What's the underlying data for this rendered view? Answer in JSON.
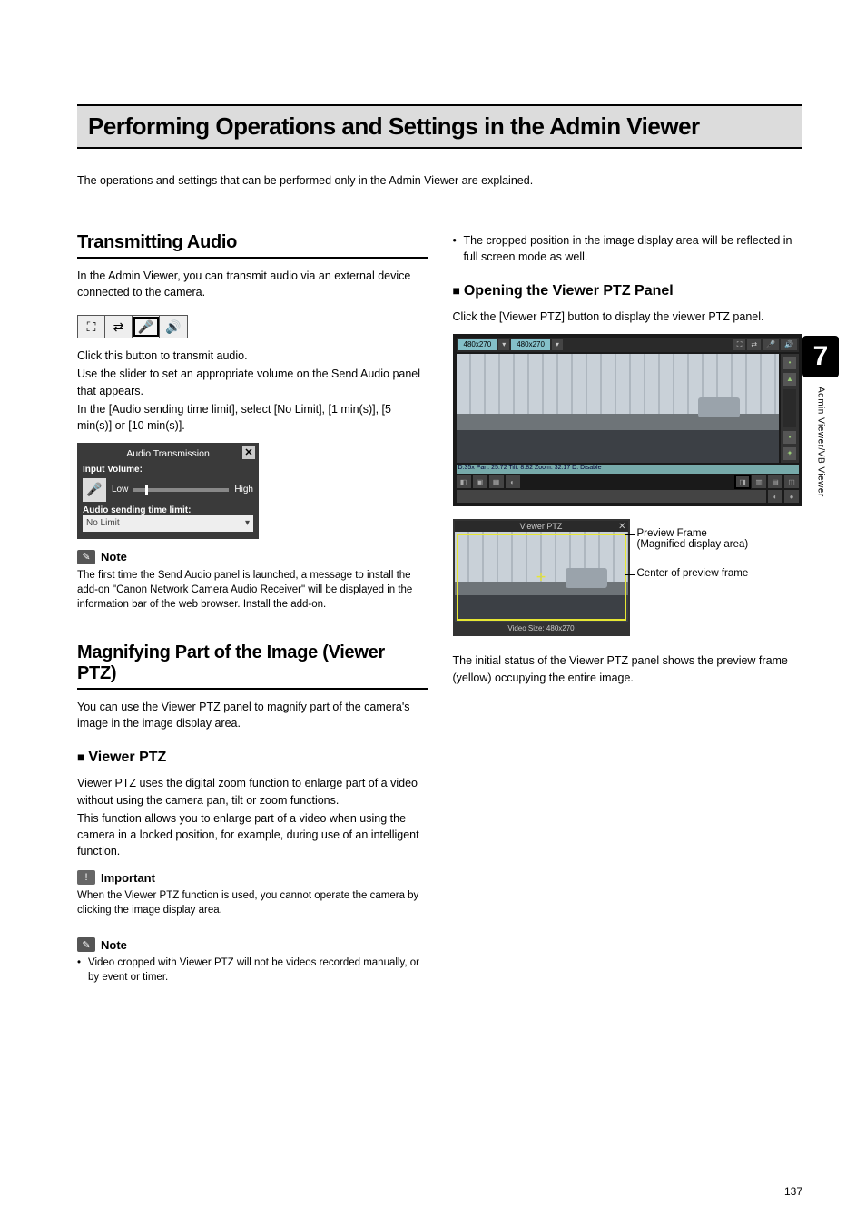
{
  "chapter": {
    "number": "7",
    "side_label": "Admin Viewer/VB Viewer"
  },
  "page_number": "137",
  "heading": "Performing Operations and Settings in the Admin Viewer",
  "intro": "The operations and settings that can be performed only in the Admin Viewer are explained.",
  "left": {
    "sec1": {
      "title": "Transmitting Audio",
      "p1": "In the Admin Viewer, you can transmit audio via an external device connected to the camera.",
      "p2": "Click this button to transmit audio.",
      "p3": "Use the slider to set an appropriate volume on the Send Audio panel that appears.",
      "p4": "In the [Audio sending time limit], select [No Limit], [1 min(s)], [5 min(s)] or [10 min(s)].",
      "audio_panel": {
        "title": "Audio Transmission",
        "input_volume": "Input Volume:",
        "low": "Low",
        "high": "High",
        "time_limit_label": "Audio sending time limit:",
        "time_limit_value": "No Limit"
      },
      "note_label": "Note",
      "note_text": "The first time the Send Audio panel is launched, a message to install the add-on \"Canon Network Camera Audio Receiver\" will be displayed in the information bar of the web browser. Install the add-on."
    },
    "sec2": {
      "title": "Magnifying Part of the Image (Viewer PTZ)",
      "p1": "You can use the Viewer PTZ panel to magnify part of the camera's image in the image display area.",
      "sub1": {
        "title": "Viewer PTZ",
        "p1": "Viewer PTZ uses the digital zoom function to enlarge part of a video without using the camera pan, tilt or zoom functions.",
        "p2": "This function allows you to enlarge part of a video when using the camera in a locked position, for example, during use of an intelligent function.",
        "important_label": "Important",
        "important_text": "When the Viewer PTZ function is used, you cannot operate the camera by clicking the image display area.",
        "note_label": "Note",
        "note_item": "Video cropped with Viewer PTZ will not be videos recorded manually, or by event or timer."
      }
    }
  },
  "right": {
    "bullet1": "The cropped position in the image display area will be reflected in full screen mode as well.",
    "sub1": {
      "title": "Opening the Viewer PTZ Panel",
      "p1": "Click the [Viewer PTZ] button to display the viewer PTZ panel.",
      "viewer": {
        "chip1": "480x270",
        "chip2": "480x270",
        "status": "D.35x Pan: 25.72 Tilt: 8.82 Zoom: 32.17 D: Disable"
      },
      "preview": {
        "title": "Viewer PTZ",
        "footer": "Video Size: 480x270",
        "label1": "Preview Frame",
        "label1b": "(Magnified display area)",
        "label2": "Center of preview frame"
      },
      "p2": "The initial status of the Viewer PTZ panel shows the preview frame (yellow) occupying the entire image."
    }
  },
  "icons": {
    "fullscreen": "⛶",
    "swap": "⇄",
    "mic": "🎤",
    "speaker": "🔊",
    "note": "✎",
    "important": "!",
    "dropdown": "▾",
    "close": "✕",
    "cross": "✛"
  }
}
